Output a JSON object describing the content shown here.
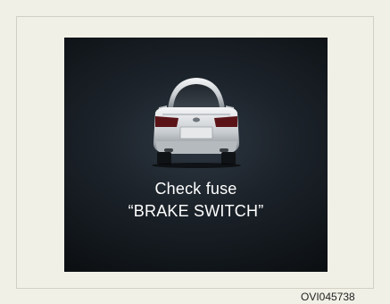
{
  "display": {
    "icon": "car-rear-icon",
    "message_line1": "Check fuse",
    "message_line2": "“BRAKE SWITCH”",
    "text_color": "#ffffff",
    "screen_color": "#0c1013"
  },
  "figure": {
    "code": "OVI045738"
  },
  "colors": {
    "background": "#f1f0e6",
    "frame_border": "#d2d0c4",
    "tail_light": "#5a1418"
  }
}
